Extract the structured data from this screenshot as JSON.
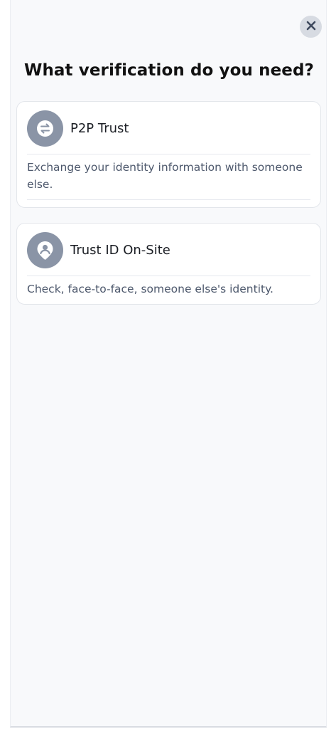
{
  "modal": {
    "title": "What verification do you need?",
    "close_icon": "close-icon"
  },
  "options": [
    {
      "title": "P2P Trust",
      "description": "Exchange your identity information with someone else.",
      "icon": "exchange-arrows-icon"
    },
    {
      "title": "Trust ID On-Site",
      "description": "Check, face-to-face, someone else's identity.",
      "icon": "location-person-icon"
    }
  ],
  "colors": {
    "background": "#f8f9fb",
    "card": "#ffffff",
    "icon_circle": "#8a94a6",
    "close_button": "#d7dbe2",
    "title_text": "#111111",
    "description_text": "#4d586c"
  }
}
